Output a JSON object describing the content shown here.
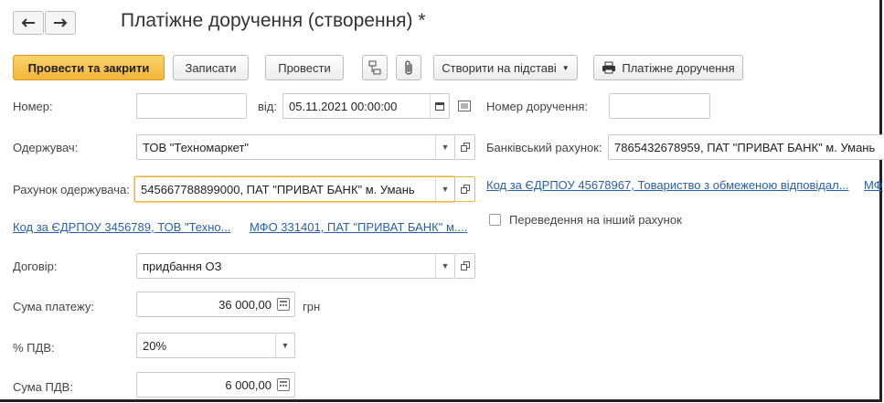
{
  "header": {
    "title": "Платіжне доручення (створення) *",
    "back_icon": "arrow-left-icon",
    "forward_icon": "arrow-right-icon"
  },
  "toolbar": {
    "post_and_close": "Провести та закрити",
    "save": "Записати",
    "post": "Провести",
    "create_based_on": "Створити на підставі",
    "print_payment_order": "Платіжне доручення"
  },
  "form": {
    "number_label": "Номер:",
    "number_value": "",
    "date_label": "від:",
    "date_value": "05.11.2021 00:00:00",
    "order_number_label": "Номер доручення:",
    "order_number_value": "",
    "recipient_label": "Одержувач:",
    "recipient_value": "ТОВ \"Техномаркет\"",
    "bank_account_label": "Банківський рахунок:",
    "bank_account_value": "7865432678959, ПАТ \"ПРИВАТ БАНК\" м. Умань",
    "recipient_account_label": "Рахунок одержувача:",
    "recipient_account_value": "545667788899000, ПАТ \"ПРИВАТ БАНК\" м. Умань",
    "own_edrpou_link": "Код за ЄДРПОУ 45678967, Товариство з обмеженою відповідал...",
    "own_mfo_link_partial": "МФ",
    "recipient_edrpou_link": "Код за ЄДРПОУ 3456789, ТОВ \"Техно...",
    "recipient_mfo_link": "МФО 331401, ПАТ \"ПРИВАТ БАНК\" м....",
    "transfer_other_account_label": "Переведення на інший рахунок",
    "contract_label": "Договір:",
    "contract_value": "придбання ОЗ",
    "amount_label": "Сума платежу:",
    "amount_value": "36 000,00",
    "currency": "грн",
    "vat_rate_label": "% ПДВ:",
    "vat_rate_value": "20%",
    "vat_amount_label": "Сума ПДВ:",
    "vat_amount_value": "6 000,00"
  },
  "colors": {
    "primary_button": "#f2b53a",
    "link": "#2a5fa8",
    "focus_border": "#f2b53a"
  }
}
